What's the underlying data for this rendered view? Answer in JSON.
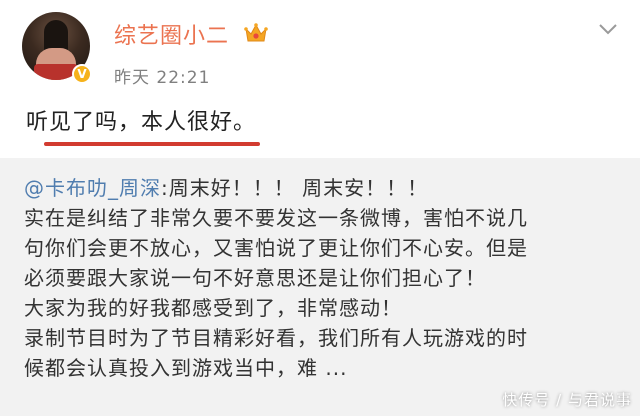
{
  "colors": {
    "username": "#eb7350",
    "mention": "#507daf",
    "underline": "#d23b30",
    "verified": "#f6b21b",
    "repost_background": "#f2f2f2"
  },
  "post": {
    "username": "综艺圈小二",
    "time": "昨天 22:21",
    "text": "听见了吗，本人很好。",
    "verified_mark": "V",
    "icons": [
      "avatar",
      "verified-badge-icon",
      "vip-crown-icon",
      "chevron-down-icon"
    ]
  },
  "repost": {
    "mention": "@卡布叻_周深",
    "first_line_rest": ":周末好！！！ 周末安！！！",
    "lines": [
      "实在是纠结了非常久要不要发这一条微博，害怕不说几",
      "句你们会更不放心，又害怕说了更让你们不心安。但是",
      "必须要跟大家说一句不好意思还是让你们担心了！",
      "大家为我的好我都感受到了，非常感动！",
      "录制节目时为了节目精彩好看，我们所有人玩游戏的时",
      "候都会认真投入到游戏当中，难 ..."
    ]
  },
  "watermark": "快传号 / 与君说事"
}
